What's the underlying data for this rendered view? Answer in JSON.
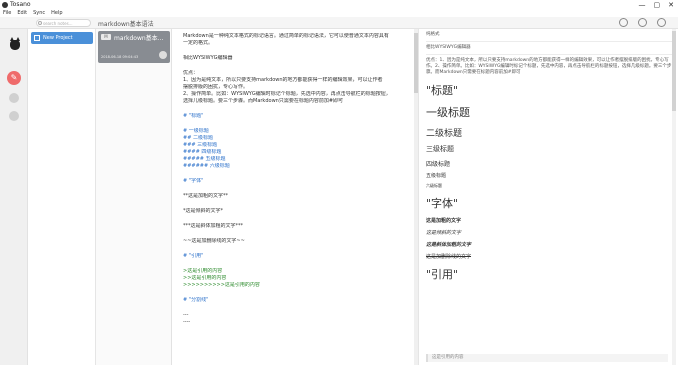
{
  "window": {
    "title": "Tosano",
    "controls": [
      "—",
      "▢",
      "✕"
    ]
  },
  "menu": [
    "File",
    "Edit",
    "Sync",
    "Help"
  ],
  "search": {
    "placeholder": "search notes..."
  },
  "doc_title": "markdown基本语法",
  "projects": [
    {
      "label": "New Project"
    }
  ],
  "notes": [
    {
      "badge": "M",
      "title": "markdown基本...",
      "date": "2018-06-18 09:04:43"
    }
  ],
  "editor": {
    "lines": [
      {
        "text": "Markdown是一种纯文本格式的标记语言。通过简单的标记语法，它可以使普通文本内容具有",
        "cls": ""
      },
      {
        "text": "一定的格式。",
        "cls": ""
      },
      {
        "text": "",
        "cls": "gap"
      },
      {
        "text": "相比WYSIWYG编辑器",
        "cls": ""
      },
      {
        "text": "",
        "cls": "gap"
      },
      {
        "text": "优点：",
        "cls": ""
      },
      {
        "text": "1、因为是纯文本，所以只要支持markdown的地方都能获得一样的编辑效果，可以让作者",
        "cls": ""
      },
      {
        "text": "摆脱排版的困扰，专心写作。",
        "cls": ""
      },
      {
        "text": "2、操作简单。比如：WYSIWYG编辑时标记个标题，先选中内容，再点击导航栏的标题按钮，",
        "cls": ""
      },
      {
        "text": "选择几级标题。要三个步骤。而Markdown只需要在标题内容前加#即可",
        "cls": ""
      },
      {
        "text": "",
        "cls": "gap"
      },
      {
        "text": "# \"标题\"",
        "cls": "h"
      },
      {
        "text": "",
        "cls": "gap"
      },
      {
        "text": "# 一级标题",
        "cls": "h"
      },
      {
        "text": "## 二级标题",
        "cls": "h"
      },
      {
        "text": "### 三级标题",
        "cls": "h"
      },
      {
        "text": "#### 四级标题",
        "cls": "h"
      },
      {
        "text": "##### 五级标题",
        "cls": "h"
      },
      {
        "text": "###### 六级标题",
        "cls": "h"
      },
      {
        "text": "",
        "cls": "gap"
      },
      {
        "text": "# \"字体\"",
        "cls": "h"
      },
      {
        "text": "",
        "cls": "gap"
      },
      {
        "text": "**这是加粗的文字**",
        "cls": ""
      },
      {
        "text": "",
        "cls": "gap"
      },
      {
        "text": "*这是倾斜的文字*",
        "cls": ""
      },
      {
        "text": "",
        "cls": "gap"
      },
      {
        "text": "***这是斜体加粗的文字***",
        "cls": ""
      },
      {
        "text": "",
        "cls": "gap"
      },
      {
        "text": "~~这是加删除线的文字~~",
        "cls": ""
      },
      {
        "text": "",
        "cls": "gap"
      },
      {
        "text": "# \"引用\"",
        "cls": "h"
      },
      {
        "text": "",
        "cls": "gap"
      },
      {
        "text": ">这是引用的内容",
        "cls": "q"
      },
      {
        "text": ">>这是引用的内容",
        "cls": "q"
      },
      {
        "text": ">>>>>>>>>>这是引用的内容",
        "cls": "q"
      },
      {
        "text": "",
        "cls": "gap"
      },
      {
        "text": "# \"分割线\"",
        "cls": "h"
      },
      {
        "text": "",
        "cls": "gap"
      },
      {
        "text": "---",
        "cls": ""
      },
      {
        "text": "----",
        "cls": ""
      }
    ]
  },
  "preview": {
    "top_label": "纯格式",
    "intro": "相比WYSIWYG编辑器",
    "para": "优点：1、因为是纯文本，所以只要支持markdown的地方都能获得一样的编辑效果，可以让作者摆脱排版的困扰，专心写作。2、操作简单。比如：WYSIWYG编辑时标记个标题，先选中内容，再点击导航栏的标题按钮，选择几级标题。要三个步骤。而Markdown只需要在标题内容前加#即可",
    "h_title": "\"标题\"",
    "h1": "一级标题",
    "h2": "二级标题",
    "h3": "三级标题",
    "h4": "四级标题",
    "h5": "五级标题",
    "h6": "六级标题",
    "h_font": "\"字体\"",
    "bold": "这是加粗的文字",
    "italic": "这是倾斜的文字",
    "bolditalic": "这是斜体加粗的文字",
    "del": "这是加删除线的文字",
    "h_quote": "\"引用\"",
    "quote": "这是引用的内容"
  }
}
